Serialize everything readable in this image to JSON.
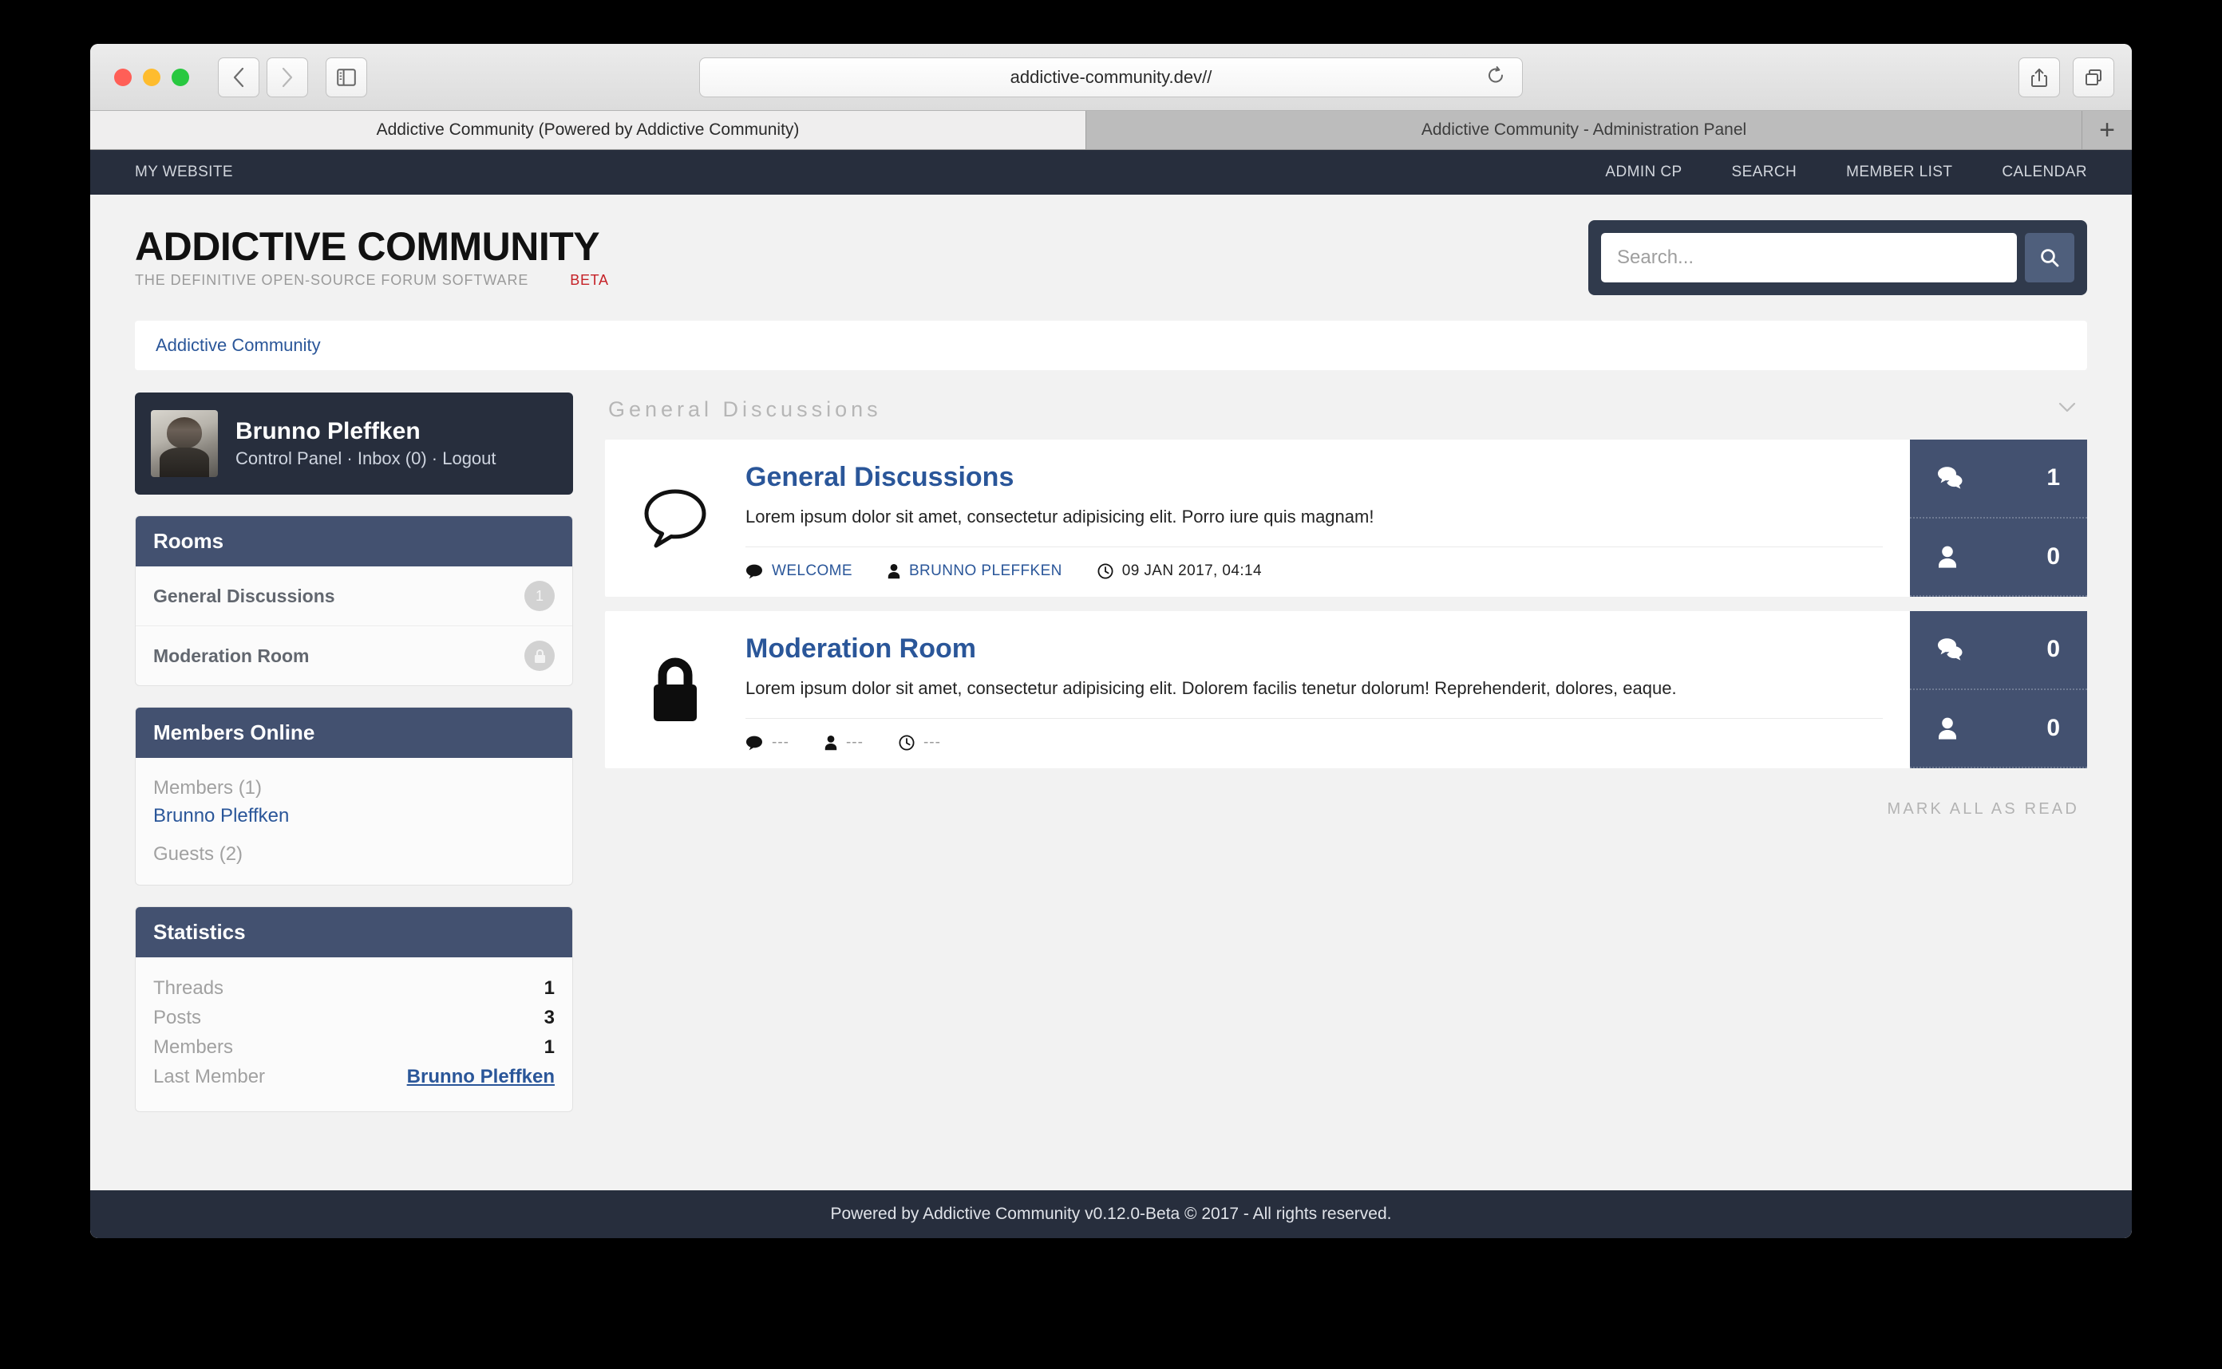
{
  "browser": {
    "url": "addictive-community.dev//",
    "tabs": [
      {
        "label": "Addictive Community (Powered by Addictive Community)",
        "active": true
      },
      {
        "label": "Addictive Community - Administration Panel",
        "active": false
      }
    ],
    "new_tab_label": "+",
    "icons": {
      "back": "back-arrow-icon",
      "forward": "forward-arrow-icon",
      "sidebar": "sidebar-toggle-icon",
      "reload": "reload-icon",
      "share": "share-icon",
      "tabs_overview": "tab-overview-icon"
    }
  },
  "topnav": {
    "brand": "MY WEBSITE",
    "links": [
      "ADMIN CP",
      "SEARCH",
      "MEMBER LIST",
      "CALENDAR"
    ]
  },
  "header": {
    "title": "ADDICTIVE COMMUNITY",
    "tagline": "THE DEFINITIVE OPEN-SOURCE FORUM SOFTWARE",
    "beta": "BETA"
  },
  "search": {
    "placeholder": "Search...",
    "value": "",
    "button_icon": "search-icon"
  },
  "breadcrumb": {
    "items": [
      "Addictive Community"
    ]
  },
  "user": {
    "name": "Brunno Pleffken",
    "links": "Control Panel · Inbox (0) · Logout"
  },
  "rooms_panel": {
    "title": "Rooms",
    "items": [
      {
        "label": "General Discussions",
        "badge": "1",
        "badge_type": "count"
      },
      {
        "label": "Moderation Room",
        "badge": "",
        "badge_type": "lock"
      }
    ]
  },
  "members_online": {
    "title": "Members Online",
    "members_label": "Members (1)",
    "member_names": [
      "Brunno Pleffken"
    ],
    "guests_label": "Guests (2)"
  },
  "statistics": {
    "title": "Statistics",
    "rows": [
      {
        "label": "Threads",
        "value": "1",
        "is_link": false
      },
      {
        "label": "Posts",
        "value": "3",
        "is_link": false
      },
      {
        "label": "Members",
        "value": "1",
        "is_link": false
      },
      {
        "label": "Last Member",
        "value": "Brunno Pleffken",
        "is_link": true
      }
    ]
  },
  "category": {
    "title": "General Discussions",
    "collapse_icon": "chevron-down-icon"
  },
  "rooms": [
    {
      "icon": "speech-bubble-icon",
      "title": "General Discussions",
      "description": "Lorem ipsum dolor sit amet, consectetur adipisicing elit. Porro iure quis magnam!",
      "meta": {
        "thread": "WELCOME",
        "author": "BRUNNO PLEFFKEN",
        "date": "09 JAN 2017, 04:14"
      },
      "stats": {
        "posts": "1",
        "members": "0"
      }
    },
    {
      "icon": "lock-icon",
      "title": "Moderation Room",
      "description": "Lorem ipsum dolor sit amet, consectetur adipisicing elit. Dolorem facilis tenetur dolorum! Reprehenderit, dolores, eaque.",
      "meta": {
        "thread": "---",
        "author": "---",
        "date": "---"
      },
      "stats": {
        "posts": "0",
        "members": "0"
      }
    }
  ],
  "mark_all_read": "MARK ALL AS READ",
  "footer": {
    "text": "Powered by Addictive Community v0.12.0-Beta © 2017 - All rights reserved."
  },
  "colors": {
    "nav_dark": "#272e3d",
    "panel_head": "#435170",
    "link_blue": "#2a5699",
    "beta_red": "#c52127",
    "page_bg": "#f2f2f2"
  }
}
